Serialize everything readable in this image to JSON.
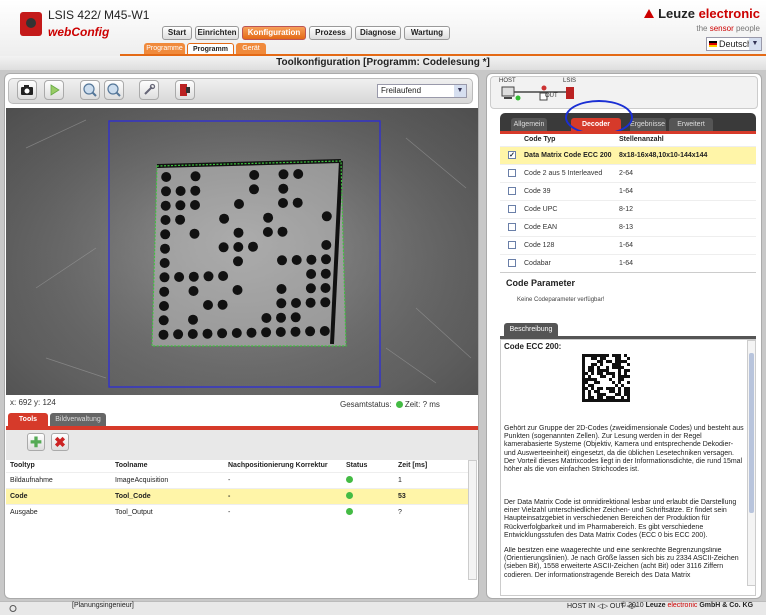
{
  "header": {
    "device_title": "LSIS 422/ M45-W1",
    "app_name": "webConfig",
    "brand": "Leuze",
    "brand_rest": "electronic",
    "slogan_a": "the",
    "slogan_b": "sensor",
    "slogan_c": "people",
    "language": "Deutsch",
    "nav_tabs": [
      "Start",
      "Einrichten",
      "Konfiguration",
      "Prozess",
      "Diagnose",
      "Wartung"
    ],
    "sub_tabs": [
      "Programme",
      "Programm",
      "Gerät"
    ]
  },
  "page_title": "Toolkonfiguration   [Programm: Codelesung *]",
  "left": {
    "mode_select": "Freilaufend",
    "coords": "x: 692 y: 124",
    "gesamtstatus_label": "Gesamtstatus:",
    "zeit": "Zeit: ? ms",
    "bottom_tabs": [
      "Tools",
      "Bildverwaltung"
    ],
    "table": {
      "headers": [
        "Tooltyp",
        "Toolname",
        "Nachpositionierung Korrektur",
        "Status",
        "Zeit [ms]"
      ],
      "rows": [
        {
          "typ": "Bildaufnahme",
          "name": "ImageAcquisition",
          "korr": "-",
          "zeit": "1"
        },
        {
          "typ": "Code",
          "name": "Tool_Code",
          "korr": "-",
          "zeit": "53"
        },
        {
          "typ": "Ausgabe",
          "name": "Tool_Output",
          "korr": "-",
          "zeit": "?"
        }
      ]
    }
  },
  "right": {
    "host": "HOST",
    "lsis": "LSIS",
    "out": "OUT",
    "tabs": [
      "Allgemein",
      "Decoder",
      "Ergebnisse",
      "Erweitert"
    ],
    "code_table": {
      "headers": [
        "Code Typ",
        "Stellenanzahl"
      ],
      "rows": [
        {
          "name": "Data Matrix Code ECC 200",
          "len": "8x18-16x48,10x10-144x144",
          "checked": true
        },
        {
          "name": "Code 2 aus 5 Interleaved",
          "len": "2-64",
          "checked": false
        },
        {
          "name": "Code 39",
          "len": "1-64",
          "checked": false
        },
        {
          "name": "Code UPC",
          "len": "8-12",
          "checked": false
        },
        {
          "name": "Code EAN",
          "len": "8-13",
          "checked": false
        },
        {
          "name": "Code 128",
          "len": "1-64",
          "checked": false
        },
        {
          "name": "Codabar",
          "len": "1-64",
          "checked": false
        }
      ]
    },
    "code_param_title": "Code Parameter",
    "code_param_none": "Keine Codeparameter verfügbar!",
    "desc_tab": "Beschreibung",
    "desc_title": "Code ECC 200:",
    "desc_p1": "Gehört zur Gruppe der 2D-Codes (zweidimensionale Codes) und besteht aus Punkten (sogenannten Zellen). Zur Lesung werden in der Regel kamerabasierte Systeme (Objektiv, Kamera und entsprechende Dekodier- und Auswerteeinheit) eingesetzt, da die üblichen Lesetechniken versagen. Der Vorteil dieses Matrixcodes liegt in der Informationsdichte, die rund 15mal höher als die von einfachen Strichcodes ist.",
    "desc_p2": "Der Data Matrix Code ist omnidirektional lesbar und erlaubt die Darstellung einer Vielzahl unterschiedlicher Zeichen- und Schriftsätze. Er findet sein Haupteinsatzgebiet in verschiedenen Bereichen der Produktion für Rückverfolgbarkeit und im Pharmabereich. Es gibt verschiedene Entwicklungsstufen des Data Matrix Codes (ECC 0 bis ECC 200).",
    "desc_p3": "Alle besitzen eine waagerechte und eine senkrechte Begrenzungslinie (Orientierungslinien). Je nach Größe lassen sich bis zu 2334 ASCII-Zeichen (sieben Bit), 1558 erweiterte ASCII-Zeichen (acht Bit) oder 3116 Ziffern codieren. Der informationstragende Bereich des Data Matrix"
  },
  "footer": {
    "role": "[Planungsingenieur]",
    "status": "HOST IN ◁▷ OUT ◁▷",
    "copyright_a": "© 2010",
    "copyright_b": "Leuze",
    "copyright_c": "electronic",
    "copyright_d": "GmbH & Co. KG"
  },
  "colors": {
    "accent_orange": "#e46a16",
    "accent_red": "#d63a2a",
    "highlight_yellow": "#fff5a8",
    "ok_green": "#44bb44"
  }
}
